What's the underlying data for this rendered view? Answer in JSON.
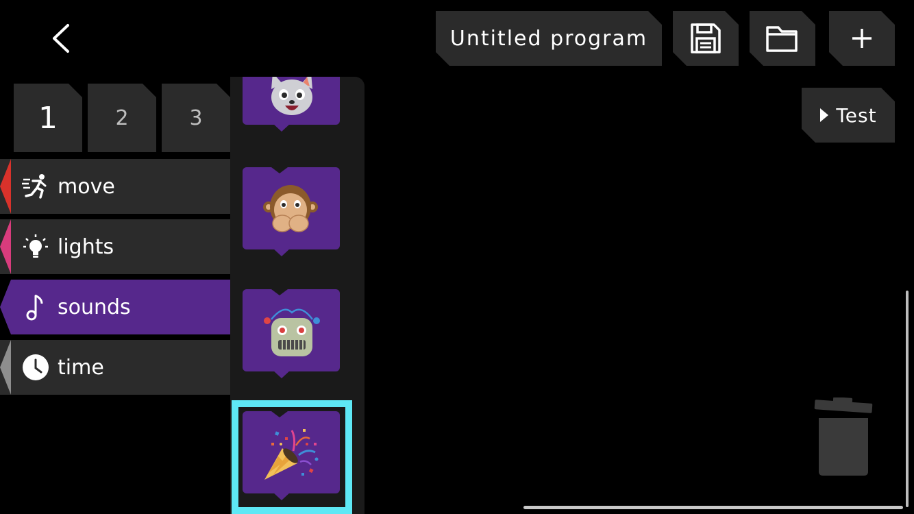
{
  "header": {
    "back_icon": "chevron-left-icon",
    "program_title": "Untitled program",
    "save_icon": "floppy-disk-icon",
    "open_icon": "folder-icon",
    "new_icon": "plus-icon"
  },
  "test_button": {
    "label": "Test",
    "icon": "play-triangle-icon"
  },
  "pages": [
    {
      "label": "1",
      "active": true
    },
    {
      "label": "2",
      "active": false
    },
    {
      "label": "3",
      "active": false
    }
  ],
  "categories": [
    {
      "label": "move",
      "icon": "running-person-icon",
      "color": "#d9322b"
    },
    {
      "label": "lights",
      "icon": "lightbulb-icon",
      "color": "#d93c7d"
    },
    {
      "label": "sounds",
      "icon": "music-note-icon",
      "color": "#56288c",
      "selected": true
    },
    {
      "label": "time",
      "icon": "clock-icon",
      "color": "#8e8e8e"
    }
  ],
  "palette_blocks": [
    {
      "icon": "cat-face-icon"
    },
    {
      "icon": "speak-no-evil-monkey-icon"
    },
    {
      "icon": "robot-face-icon"
    },
    {
      "icon": "party-popper-icon",
      "highlighted": true
    }
  ],
  "trash_icon": "trash-can-icon",
  "colors": {
    "accent_purple": "#56288c",
    "highlight_cyan": "#5ee8f5",
    "tile_gray": "#2b2b2b"
  }
}
